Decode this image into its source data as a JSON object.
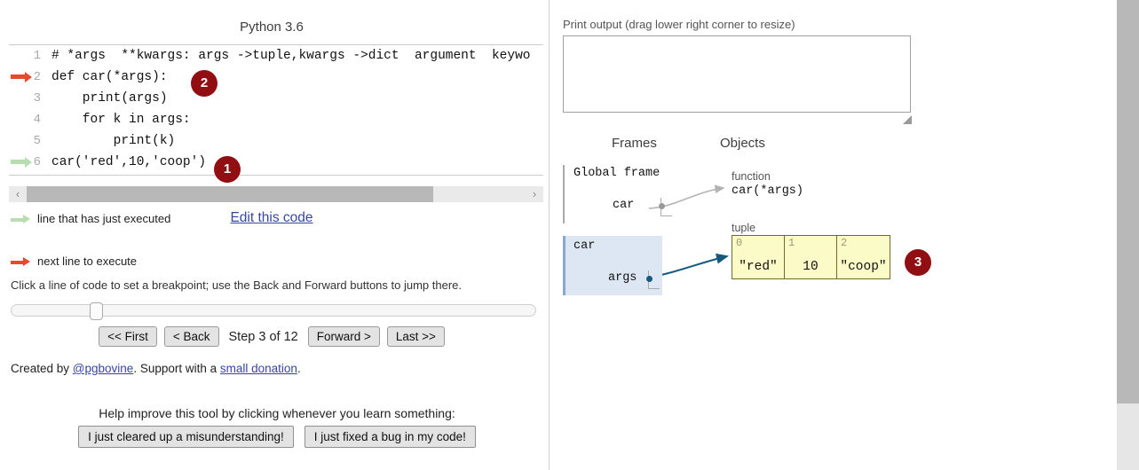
{
  "left": {
    "code_title": "Python 3.6",
    "code_lines": [
      {
        "num": "1",
        "text": "# *args  **kwargs: args ->tuple,kwargs ->dict  argument  keywo",
        "marker": "none"
      },
      {
        "num": "2",
        "text": "def car(*args):",
        "marker": "next"
      },
      {
        "num": "3",
        "text": "    print(args)",
        "marker": "none"
      },
      {
        "num": "4",
        "text": "    for k in args:",
        "marker": "none"
      },
      {
        "num": "5",
        "text": "        print(k)",
        "marker": "none"
      },
      {
        "num": "6",
        "text": "car('red',10,'coop')",
        "marker": "executed"
      }
    ],
    "edit_link": "Edit this code",
    "legend": {
      "executed": "line that has just executed",
      "next": "next line to execute"
    },
    "breakpoint_hint": "Click a line of code to set a breakpoint; use the Back and Forward buttons to jump there.",
    "controls": {
      "first": "<< First",
      "back": "< Back",
      "step_label": "Step 3 of 12",
      "forward": "Forward >",
      "last": "Last >>"
    },
    "credits": {
      "prefix": "Created by ",
      "author": "@pgbovine",
      "middle": ". Support with a ",
      "donation": "small donation",
      "suffix": "."
    },
    "help": {
      "prompt": "Help improve this tool by clicking whenever you learn something:",
      "button_misunderstanding": "I just cleared up a misunderstanding!",
      "button_bug": "I just fixed a bug in my code!"
    },
    "hscroll": {
      "left_arrow": "‹",
      "right_arrow": "›"
    }
  },
  "right": {
    "print_output_label": "Print output (drag lower right corner to resize)",
    "print_output_value": "",
    "frames_header": "Frames",
    "objects_header": "Objects",
    "global_frame": {
      "title": "Global frame",
      "vars": [
        {
          "name": "car"
        }
      ]
    },
    "car_frame": {
      "title": "car",
      "vars": [
        {
          "name": "args"
        }
      ]
    },
    "function_object": {
      "type": "function",
      "value": "car(*args)"
    },
    "tuple_object": {
      "type": "tuple",
      "cells": [
        {
          "index": "0",
          "value": "\"red\""
        },
        {
          "index": "1",
          "value": "10"
        },
        {
          "index": "2",
          "value": "\"coop\""
        }
      ]
    }
  },
  "badges": {
    "one": "1",
    "two": "2",
    "three": "3"
  },
  "colors": {
    "badge": "#910e12",
    "next_arrow": "#e8482c",
    "executed_arrow": "#b7ddb0",
    "frame_highlight": "#dde6f3",
    "tuple_fill": "#fbfbc8",
    "link": "#3447a6"
  }
}
